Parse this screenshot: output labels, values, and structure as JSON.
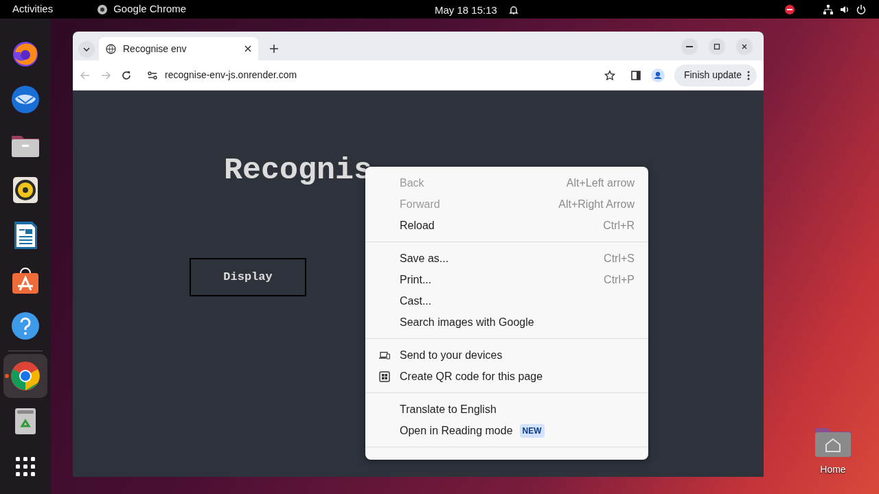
{
  "top_bar": {
    "activities": "Activities",
    "app_name": "Google Chrome",
    "clock": "May 18  15:13"
  },
  "dock": {
    "items": [
      {
        "kind": "fox-globe",
        "running": false
      },
      {
        "kind": "bird-mail",
        "running": false
      },
      {
        "kind": "folder",
        "running": false
      },
      {
        "kind": "speaker",
        "running": false
      },
      {
        "kind": "document",
        "running": false
      },
      {
        "kind": "store-bag",
        "running": false
      },
      {
        "kind": "help",
        "running": false
      },
      {
        "kind": "browser",
        "running": true
      },
      {
        "kind": "trash",
        "running": false
      },
      {
        "kind": "app-grid",
        "running": false
      }
    ]
  },
  "browser": {
    "tabs": [
      {
        "title": "Recognise env",
        "selected": true
      }
    ],
    "url": "recognise-env-js.onrender.com",
    "update_button": "Finish update",
    "page": {
      "heading": "Recognis",
      "button": "Display"
    }
  },
  "context_menu": {
    "groups": [
      [
        {
          "kind": "plain",
          "label": "Back",
          "shortcut": "Alt+Left arrow",
          "disabled": true
        },
        {
          "kind": "plain",
          "label": "Forward",
          "shortcut": "Alt+Right Arrow",
          "disabled": true
        },
        {
          "kind": "plain",
          "label": "Reload",
          "shortcut": "Ctrl+R",
          "disabled": false
        }
      ],
      [
        {
          "kind": "plain",
          "label": "Save as...",
          "shortcut": "Ctrl+S",
          "disabled": false
        },
        {
          "kind": "plain",
          "label": "Print...",
          "shortcut": "Ctrl+P",
          "disabled": false
        },
        {
          "kind": "plain",
          "label": "Cast...",
          "disabled": false
        },
        {
          "kind": "plain",
          "label": "Search images with Google",
          "disabled": false
        }
      ],
      [
        {
          "kind": "devices",
          "label": "Send to your devices",
          "disabled": false
        },
        {
          "kind": "qr",
          "label": "Create QR code for this page",
          "disabled": false
        }
      ],
      [
        {
          "kind": "plain",
          "label": "Translate to English",
          "disabled": false
        },
        {
          "kind": "plain",
          "label": "Open in Reading mode",
          "badge": "NEW",
          "disabled": false
        }
      ]
    ]
  },
  "desktop_icons": [
    {
      "label": "Home"
    }
  ]
}
